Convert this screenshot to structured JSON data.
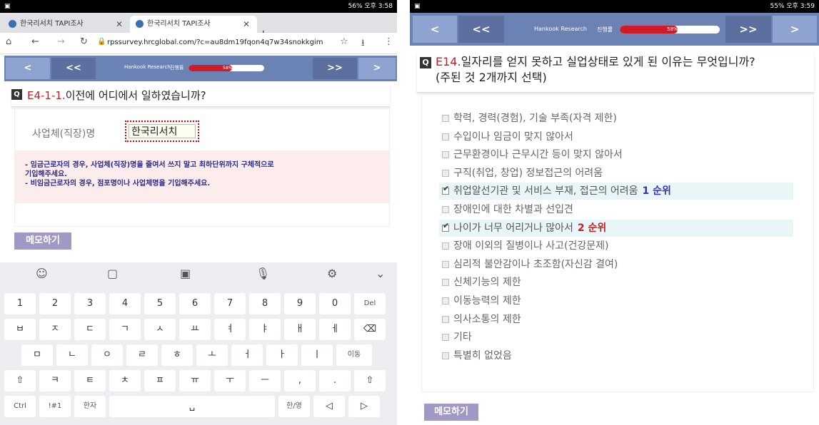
{
  "left": {
    "status_right": "56% 오후 3:58",
    "tabs": [
      {
        "title": "한국리서치 TAPI조사"
      },
      {
        "title": "한국리서치 TAPI조사"
      }
    ],
    "new_tab": "+",
    "url": "rpssurvey.hrcglobal.com/?c=au8dm19fqon4q7w34snokkgim",
    "nav": {
      "first": "<",
      "prev": "<<",
      "next": ">>",
      "last": ">",
      "brand": "Hankook Research",
      "progress_label": "진행률",
      "progress_text": "58%",
      "progress": 0.58
    },
    "question": {
      "icon": "Q",
      "number": "E4-1-1.",
      "text": "이전에 어디에서 일하였습니까?"
    },
    "field_label": "사업체(직장)명",
    "field_value": "한국리서치",
    "notice_line1": "- 임금근로자의 경우, 사업체(직장)명을 줄여서 쓰지 말고 최하단위까지 구체적으로",
    "notice_line2": "기입해주세요.",
    "notice_line3": "- 비임금근로자의 경우, 점포명이나 사업체명을 기입해주세요.",
    "memo": "메모하기",
    "keyboard": {
      "row1": [
        "1",
        "2",
        "3",
        "4",
        "5",
        "6",
        "7",
        "8",
        "9",
        "0",
        "Del"
      ],
      "row2": [
        "ㅂ",
        "ㅈ",
        "ㄷ",
        "ㄱ",
        "ㅅ",
        "ㅛ",
        "ㅕ",
        "ㅑ",
        "ㅐ",
        "ㅔ",
        "⌫"
      ],
      "row3": [
        "ㅁ",
        "ㄴ",
        "ㅇ",
        "ㄹ",
        "ㅎ",
        "ㅗ",
        "ㅓ",
        "ㅏ",
        "ㅣ",
        "이동"
      ],
      "row4": [
        "⇧",
        "ㅋ",
        "ㅌ",
        "ㅊ",
        "ㅍ",
        "ㅠ",
        "ㅜ",
        "ㅡ",
        ",",
        ".",
        "⇧"
      ],
      "row5": [
        "Ctrl",
        "!#1",
        "한자",
        "␣",
        "한/영",
        "◁",
        "▷"
      ]
    }
  },
  "right": {
    "status_right": "55% 오후 3:59",
    "nav": {
      "first": "<",
      "prev": "<<",
      "next": ">>",
      "last": ">",
      "brand": "Hankook Research",
      "progress_label": "진행률",
      "progress_text": "58%",
      "progress": 0.58
    },
    "question": {
      "icon": "Q",
      "number": "E14.",
      "text": "일자리를 얻지 못하고 실업상태로 있게 된 이유는 무엇입니까?",
      "text2": "(주된 것 2개까지 선택)"
    },
    "options": [
      {
        "label": "학력, 경력(경험), 기술 부족(자격 제한)",
        "checked": false,
        "rank": ""
      },
      {
        "label": "수입이나 임금이 맞지 않아서",
        "checked": false,
        "rank": ""
      },
      {
        "label": "근무환경이나 근무시간 등이 맞지 않아서",
        "checked": false,
        "rank": ""
      },
      {
        "label": "구직(취업, 창업) 정보접근의 어려움",
        "checked": false,
        "rank": ""
      },
      {
        "label": "취업알선기관 및 서비스 부재, 접근의 어려움",
        "checked": true,
        "rank": "1 순위"
      },
      {
        "label": "장애인에 대한 차별과 선입견",
        "checked": false,
        "rank": ""
      },
      {
        "label": "나이가 너무 어리거나 많아서",
        "checked": true,
        "rank": "2 순위"
      },
      {
        "label": "장애 이외의 질병이나 사고(건강문제)",
        "checked": false,
        "rank": ""
      },
      {
        "label": "심리적 불안감이나 초조함(자신감 결여)",
        "checked": false,
        "rank": ""
      },
      {
        "label": "신체기능의 제한",
        "checked": false,
        "rank": ""
      },
      {
        "label": "이동능력의 제한",
        "checked": false,
        "rank": ""
      },
      {
        "label": "의사소통의 제한",
        "checked": false,
        "rank": ""
      },
      {
        "label": "기타",
        "checked": false,
        "rank": ""
      },
      {
        "label": "특별히 없었음",
        "checked": false,
        "rank": ""
      }
    ],
    "memo": "메모하기"
  }
}
